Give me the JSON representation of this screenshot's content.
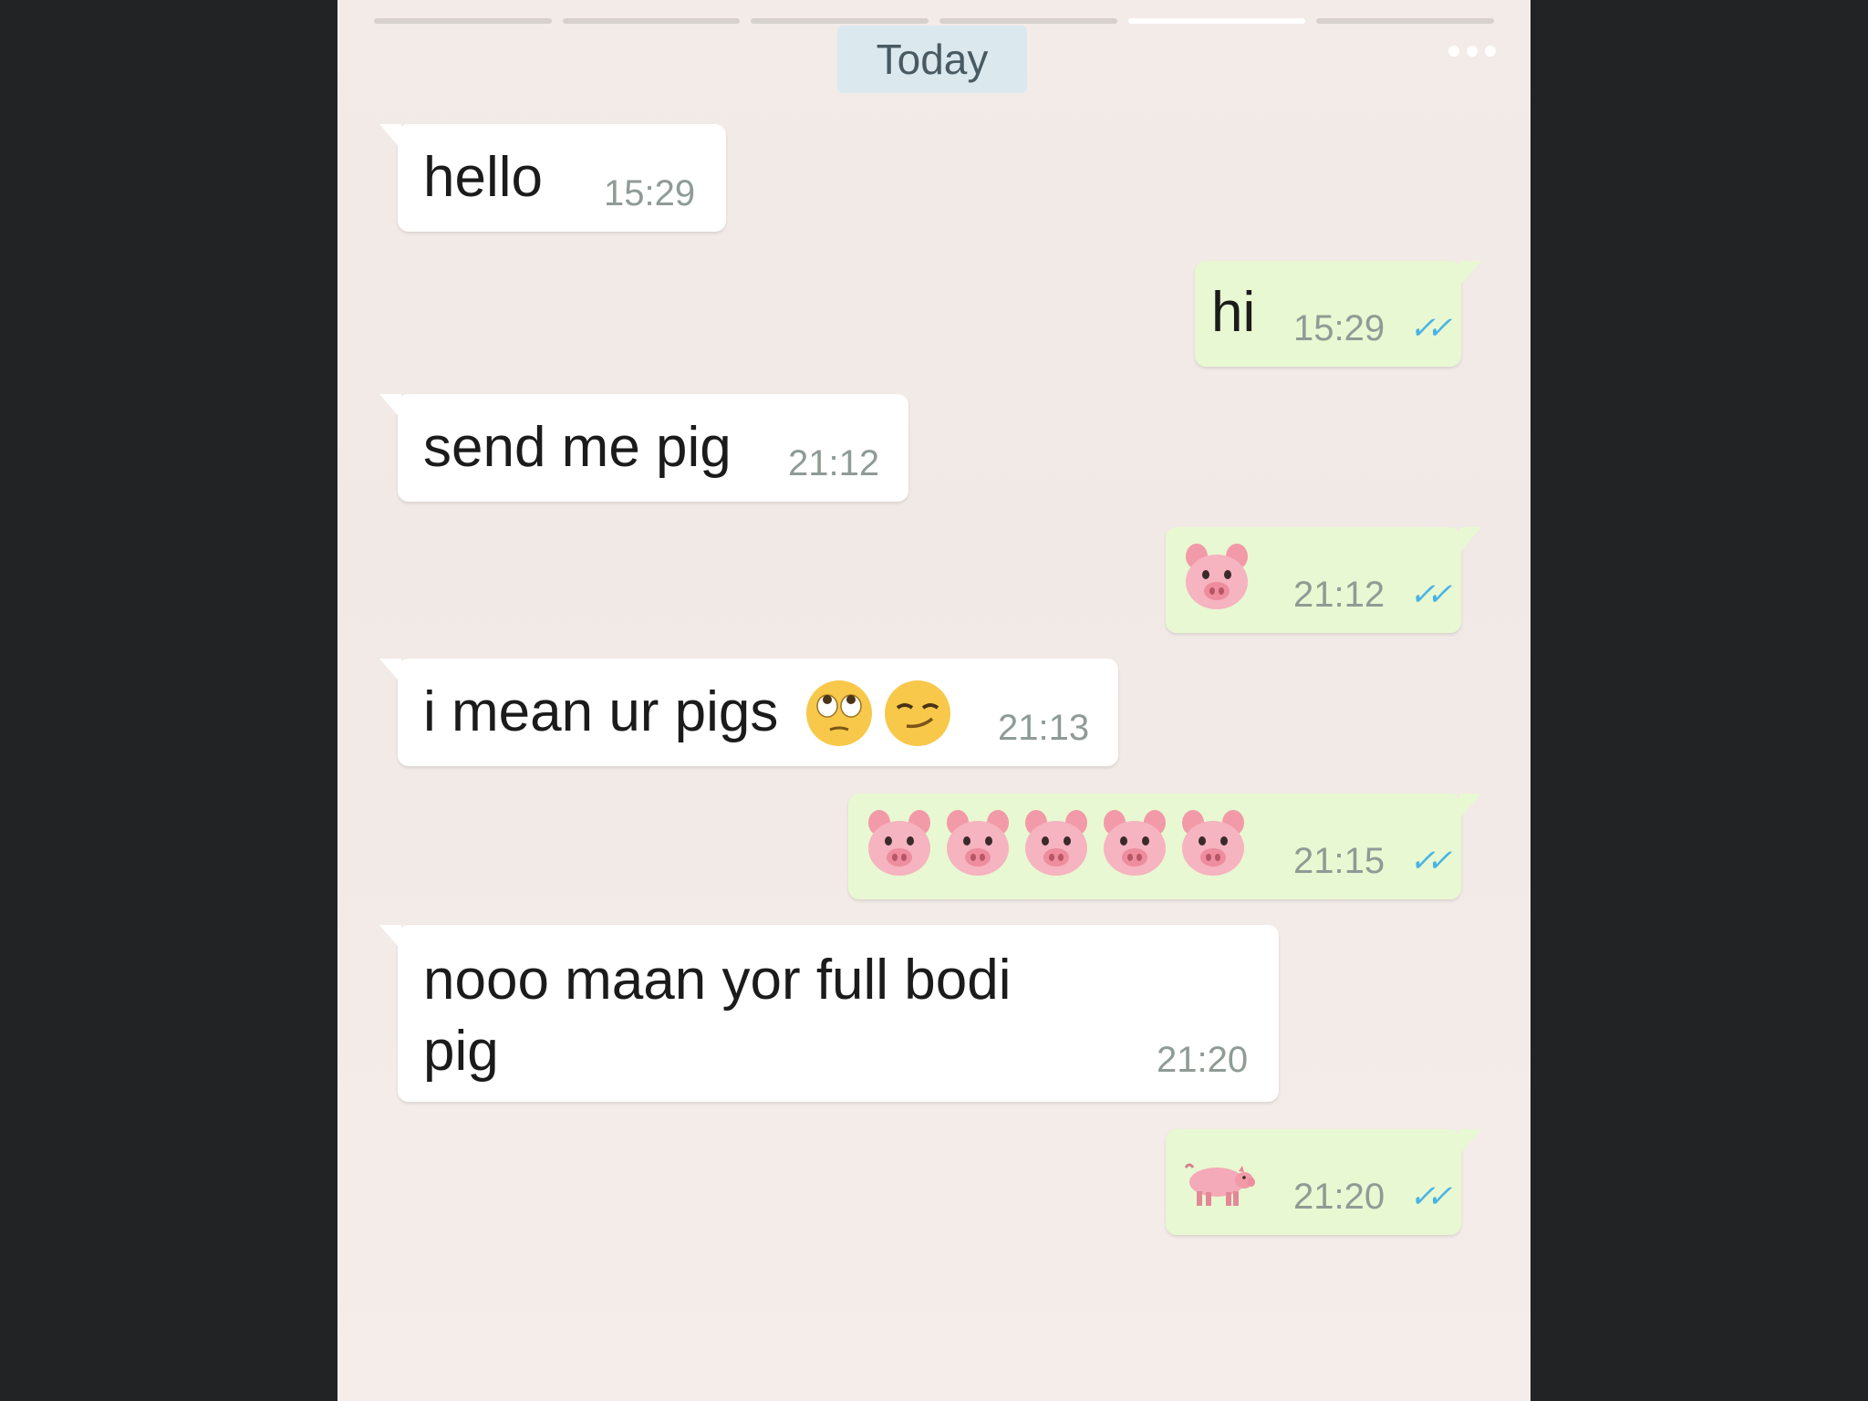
{
  "chat": {
    "date_label": "Today",
    "progress_segments": 6,
    "active_segment": 5,
    "messages": [
      {
        "direction": "in",
        "text": "hello",
        "time": "15:29"
      },
      {
        "direction": "out",
        "text": "hi",
        "time": "15:29",
        "status_icon": "double-check-icon"
      },
      {
        "direction": "in",
        "text": "send me pig",
        "time": "21:12"
      },
      {
        "direction": "out",
        "emoji": [
          "pig-face"
        ],
        "time": "21:12",
        "status_icon": "double-check-icon"
      },
      {
        "direction": "in",
        "text": "i mean ur pigs",
        "emoji": [
          "face-with-rolling-eyes",
          "smirking-face"
        ],
        "time": "21:13"
      },
      {
        "direction": "out",
        "emoji": [
          "pig-face",
          "pig-face",
          "pig-face",
          "pig-face",
          "pig-face"
        ],
        "time": "21:15",
        "status_icon": "double-check-icon"
      },
      {
        "direction": "in",
        "text": "nooo maan yor full bodi\npig",
        "time": "21:20"
      },
      {
        "direction": "out",
        "emoji": [
          "pig"
        ],
        "time": "21:20",
        "status_icon": "double-check-icon"
      }
    ]
  },
  "colors": {
    "incoming_bubble": "#ffffff",
    "outgoing_bubble": "#e8f8d2",
    "read_ticks": "#48b3e6",
    "date_chip": "#dbe9ef"
  }
}
